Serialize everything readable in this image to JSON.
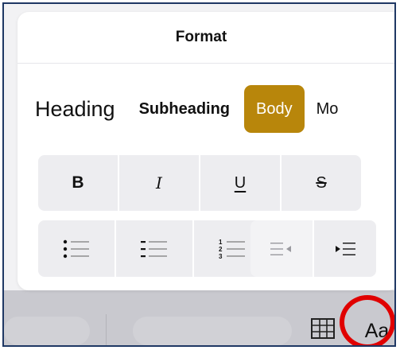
{
  "panel": {
    "title": "Format"
  },
  "styles": {
    "heading": "Heading",
    "subheading": "Subheading",
    "body": "Body",
    "more": "Mo"
  },
  "styles_selected": "Body",
  "format_buttons": {
    "bold": "B",
    "italic": "I",
    "underline": "U",
    "strikethrough": "S"
  },
  "toolbar": {
    "text_format": "Aa"
  },
  "colors": {
    "accent": "#b8860b",
    "highlight": "#e00000",
    "frame": "#1f3864"
  },
  "icons": {
    "bullet_list": "bullet-list-icon",
    "dash_list": "dash-list-icon",
    "numbered_list": "numbered-list-icon",
    "outdent": "outdent-icon",
    "indent": "indent-icon",
    "table": "table-icon"
  }
}
